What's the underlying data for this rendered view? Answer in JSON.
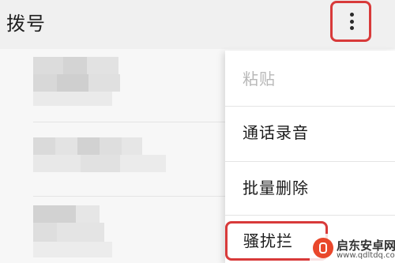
{
  "header": {
    "title": "拨号",
    "more_icon": "more-vertical-icon"
  },
  "menu": {
    "items": [
      {
        "label": "粘贴",
        "enabled": false
      },
      {
        "label": "通话录音",
        "enabled": true
      },
      {
        "label": "批量删除",
        "enabled": true
      },
      {
        "label": "骚扰拦",
        "enabled": true,
        "highlighted": true
      }
    ]
  },
  "watermark": {
    "name": "启东安卓网",
    "url": "www.qdltdq.com"
  },
  "colors": {
    "highlight_border": "#d83a3a",
    "disabled_text": "#b8b8b8"
  }
}
